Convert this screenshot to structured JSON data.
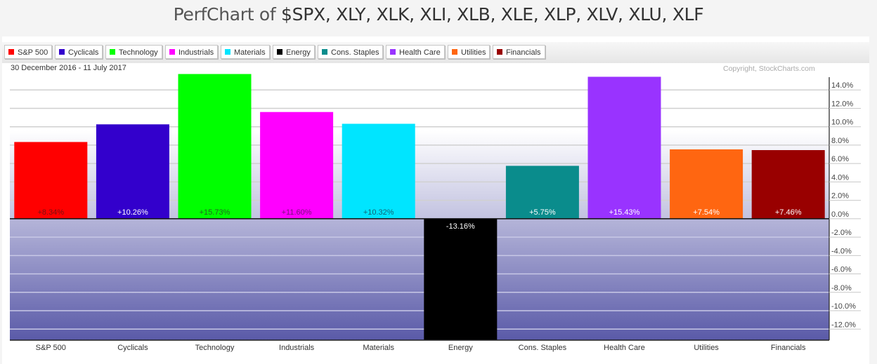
{
  "page": {
    "title_prefix": "PerfChart of ",
    "title_tickers": "$SPX, XLY, XLK, XLI, XLB, XLE, XLP, XLV, XLU, XLF"
  },
  "chart_header": {
    "date_range": "30 December 2016 - 11 July 2017",
    "copyright": "Copyright, StockCharts.com"
  },
  "legend": [
    {
      "label": "S&P 500",
      "color": "#ff0000"
    },
    {
      "label": "Cyclicals",
      "color": "#3300cc"
    },
    {
      "label": "Technology",
      "color": "#00ff00"
    },
    {
      "label": "Industrials",
      "color": "#ff00ff"
    },
    {
      "label": "Materials",
      "color": "#00e5ff"
    },
    {
      "label": "Energy",
      "color": "#000000"
    },
    {
      "label": "Cons. Staples",
      "color": "#0a8c8c"
    },
    {
      "label": "Health Care",
      "color": "#9933ff"
    },
    {
      "label": "Utilities",
      "color": "#ff6611"
    },
    {
      "label": "Financials",
      "color": "#990000"
    }
  ],
  "chart_data": {
    "type": "bar",
    "title": "PerfChart of $SPX, XLY, XLK, XLI, XLB, XLE, XLP, XLV, XLU, XLF",
    "subtitle": "30 December 2016 - 11 July 2017",
    "xlabel": "",
    "ylabel": "",
    "categories": [
      "S&P 500",
      "Cyclicals",
      "Technology",
      "Industrials",
      "Materials",
      "Energy",
      "Cons. Staples",
      "Health Care",
      "Utilities",
      "Financials"
    ],
    "values": [
      8.34,
      10.26,
      15.73,
      11.6,
      10.32,
      -13.16,
      5.75,
      15.43,
      7.54,
      7.46
    ],
    "value_labels": [
      "+8.34%",
      "+10.26%",
      "+15.73%",
      "+11.60%",
      "+10.32%",
      "-13.16%",
      "+5.75%",
      "+15.43%",
      "+7.54%",
      "+7.46%"
    ],
    "label_colors": [
      "#7a1010",
      "#ffffff",
      "#226622",
      "#7a107a",
      "#116677",
      "#ffffff",
      "#ffffff",
      "#ffffff",
      "#ffffff",
      "#ffffff"
    ],
    "colors": [
      "#ff0000",
      "#3300cc",
      "#00ff00",
      "#ff00ff",
      "#00e5ff",
      "#000000",
      "#0a8c8c",
      "#9933ff",
      "#ff6611",
      "#990000"
    ],
    "ylim": [
      -13.2,
      16.0
    ],
    "yticks": [
      14,
      12,
      10,
      8,
      6,
      4,
      2,
      0,
      -2,
      -4,
      -6,
      -8,
      -10,
      -12
    ],
    "ytick_labels": [
      "14.0%",
      "12.0%",
      "10.0%",
      "8.0%",
      "6.0%",
      "4.0%",
      "2.0%",
      "0.0%",
      "-2.0%",
      "-4.0%",
      "-6.0%",
      "-8.0%",
      "-10.0%",
      "-12.0%"
    ],
    "y_axis_position": "right",
    "grid": true,
    "legend_position": "top"
  }
}
